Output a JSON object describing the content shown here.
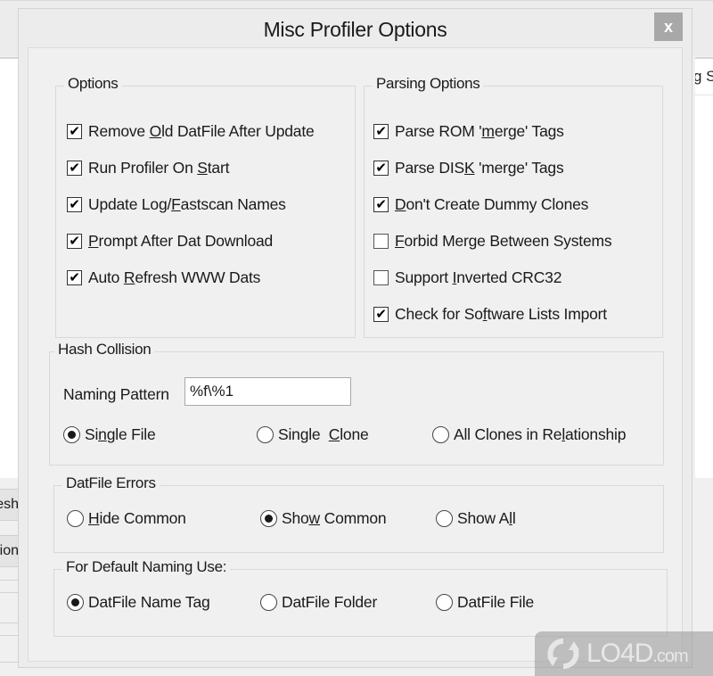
{
  "background": {
    "right_text_fragment": "g S",
    "left_buttons": [
      "esh",
      "tion"
    ]
  },
  "dialog": {
    "title": "Misc Profiler Options",
    "close_label": "x"
  },
  "options_group": {
    "legend": "Options",
    "items": [
      {
        "pre": "Remove ",
        "u": "O",
        "post": "ld DatFile After Update",
        "checked": true
      },
      {
        "pre": "Run Profiler On ",
        "u": "S",
        "post": "tart",
        "checked": true
      },
      {
        "pre": "Update Log/",
        "u": "F",
        "post": "astscan Names",
        "checked": true
      },
      {
        "pre": "",
        "u": "P",
        "post": "rompt After Dat Download",
        "checked": true
      },
      {
        "pre": "Auto ",
        "u": "R",
        "post": "efresh WWW Dats",
        "checked": true
      }
    ]
  },
  "parsing_group": {
    "legend": "Parsing Options",
    "items": [
      {
        "pre": "Parse ROM '",
        "u": "m",
        "post": "erge' Tags",
        "checked": true
      },
      {
        "pre": "Parse DIS",
        "u": "K",
        "post": " 'merge' Tags",
        "checked": true
      },
      {
        "pre": "",
        "u": "D",
        "post": "on't Create Dummy Clones",
        "checked": true
      },
      {
        "pre": "",
        "u": "F",
        "post": "orbid Merge Between Systems",
        "checked": false
      },
      {
        "pre": "Support ",
        "u": "I",
        "post": "nverted CRC32",
        "checked": false
      },
      {
        "pre": "Check for So",
        "u": "f",
        "post": "tware Lists Import",
        "checked": true
      }
    ]
  },
  "hash_group": {
    "legend": "Hash Collision",
    "naming_label": "Naming Pattern",
    "naming_value": "%f\\%1",
    "radios": [
      {
        "pre": "Si",
        "u": "n",
        "post": "gle File",
        "selected": true
      },
      {
        "pre": "Single  ",
        "u": "C",
        "post": "lone",
        "selected": false
      },
      {
        "pre": "All Clones in Re",
        "u": "l",
        "post": "ationship",
        "selected": false
      }
    ]
  },
  "errors_group": {
    "legend": "DatFile Errors",
    "radios": [
      {
        "pre": "",
        "u": "H",
        "post": "ide Common",
        "selected": false
      },
      {
        "pre": "Sho",
        "u": "w",
        "post": " Common",
        "selected": true
      },
      {
        "pre": "Show A",
        "u": "l",
        "post": "l",
        "selected": false
      }
    ]
  },
  "naming_group": {
    "legend": "For Default Naming Use:",
    "radios": [
      {
        "pre": "DatFile Name Tag",
        "u": "",
        "post": "",
        "selected": true
      },
      {
        "pre": "DatFile Folder",
        "u": "",
        "post": "",
        "selected": false
      },
      {
        "pre": "DatFile File",
        "u": "",
        "post": "",
        "selected": false
      }
    ]
  },
  "watermark": {
    "text": "LO4D",
    "suffix": ".com"
  }
}
